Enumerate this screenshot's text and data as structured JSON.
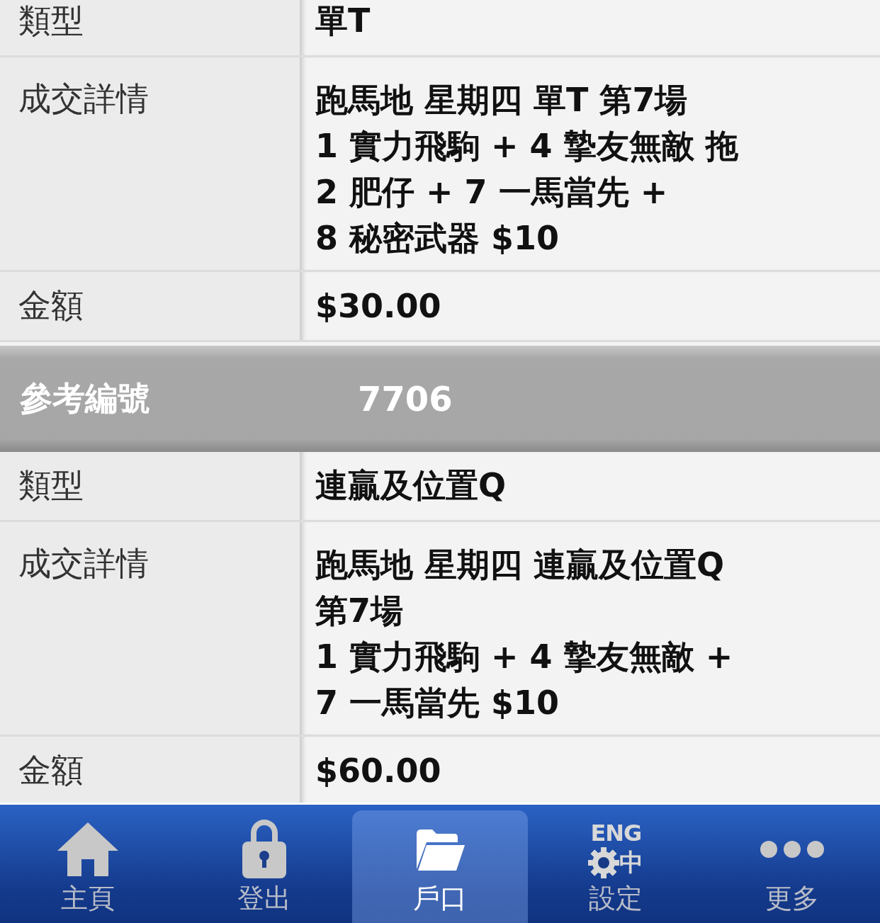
{
  "sections": [
    {
      "rows": [
        {
          "kind": "single",
          "label": "類型",
          "lines": [
            "單T"
          ]
        },
        {
          "kind": "detail",
          "label": "成交詳情",
          "lines": [
            "跑馬地 星期四 單T 第7場",
            "1 實力飛駒 + 4 摯友無敵 拖",
            "2 肥仔 + 7 一馬當先 +",
            "8 秘密武器 $10"
          ]
        },
        {
          "kind": "single",
          "label": "金額",
          "lines": [
            "$30.00"
          ]
        }
      ]
    },
    {
      "header": {
        "label": "參考編號",
        "value": "7706"
      },
      "rows": [
        {
          "kind": "single",
          "label": "類型",
          "lines": [
            "連贏及位置Q"
          ]
        },
        {
          "kind": "detail",
          "label": "成交詳情",
          "lines": [
            "跑馬地 星期四 連贏及位置Q",
            "第7場",
            "1 實力飛駒 + 4 摯友無敵 +",
            "7 一馬當先 $10"
          ]
        },
        {
          "kind": "single",
          "label": "金額",
          "lines": [
            "$60.00"
          ]
        }
      ]
    }
  ],
  "tabs": [
    {
      "kind": "home",
      "label": "主頁",
      "selected": false
    },
    {
      "kind": "lock",
      "label": "登出",
      "selected": false
    },
    {
      "kind": "folder",
      "label": "戶口",
      "selected": true
    },
    {
      "kind": "language",
      "label": "設定",
      "selected": false,
      "icon_texts": [
        "ENG",
        "中"
      ]
    },
    {
      "kind": "more",
      "label": "更多",
      "selected": false
    }
  ]
}
